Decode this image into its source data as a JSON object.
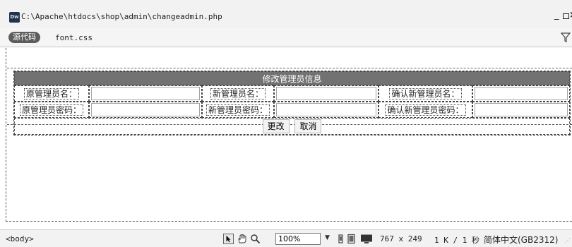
{
  "window": {
    "app_icon": "Dw",
    "title_path": "C:\\Apache\\htdocs\\shop\\admin\\changeadmin.php",
    "minimize_label": "_",
    "close_label": "×"
  },
  "related_files": {
    "source_code_label": "源代码",
    "files": [
      "font.css"
    ]
  },
  "form": {
    "header": "修改管理员信息",
    "rows": [
      [
        {
          "label": "原管理员名："
        },
        {
          "label": "新管理员名："
        },
        {
          "label": "确认新管理员名："
        }
      ],
      [
        {
          "label": "原管理员密码："
        },
        {
          "label": "新管理员密码："
        },
        {
          "label": "确认新管理员密码："
        }
      ]
    ],
    "submit_label": "更改",
    "cancel_label": "取消"
  },
  "statusbar": {
    "tag": "<body>",
    "zoom": "100%",
    "window_size": "767 x 249",
    "file_size": "1 K / 1 秒",
    "encoding": "简体中文(GB2312)"
  },
  "icons": {
    "filter": "filter-icon",
    "select_tool": "arrow-pointer-icon",
    "hand_tool": "hand-icon",
    "zoom_tool": "magnifier-icon"
  }
}
